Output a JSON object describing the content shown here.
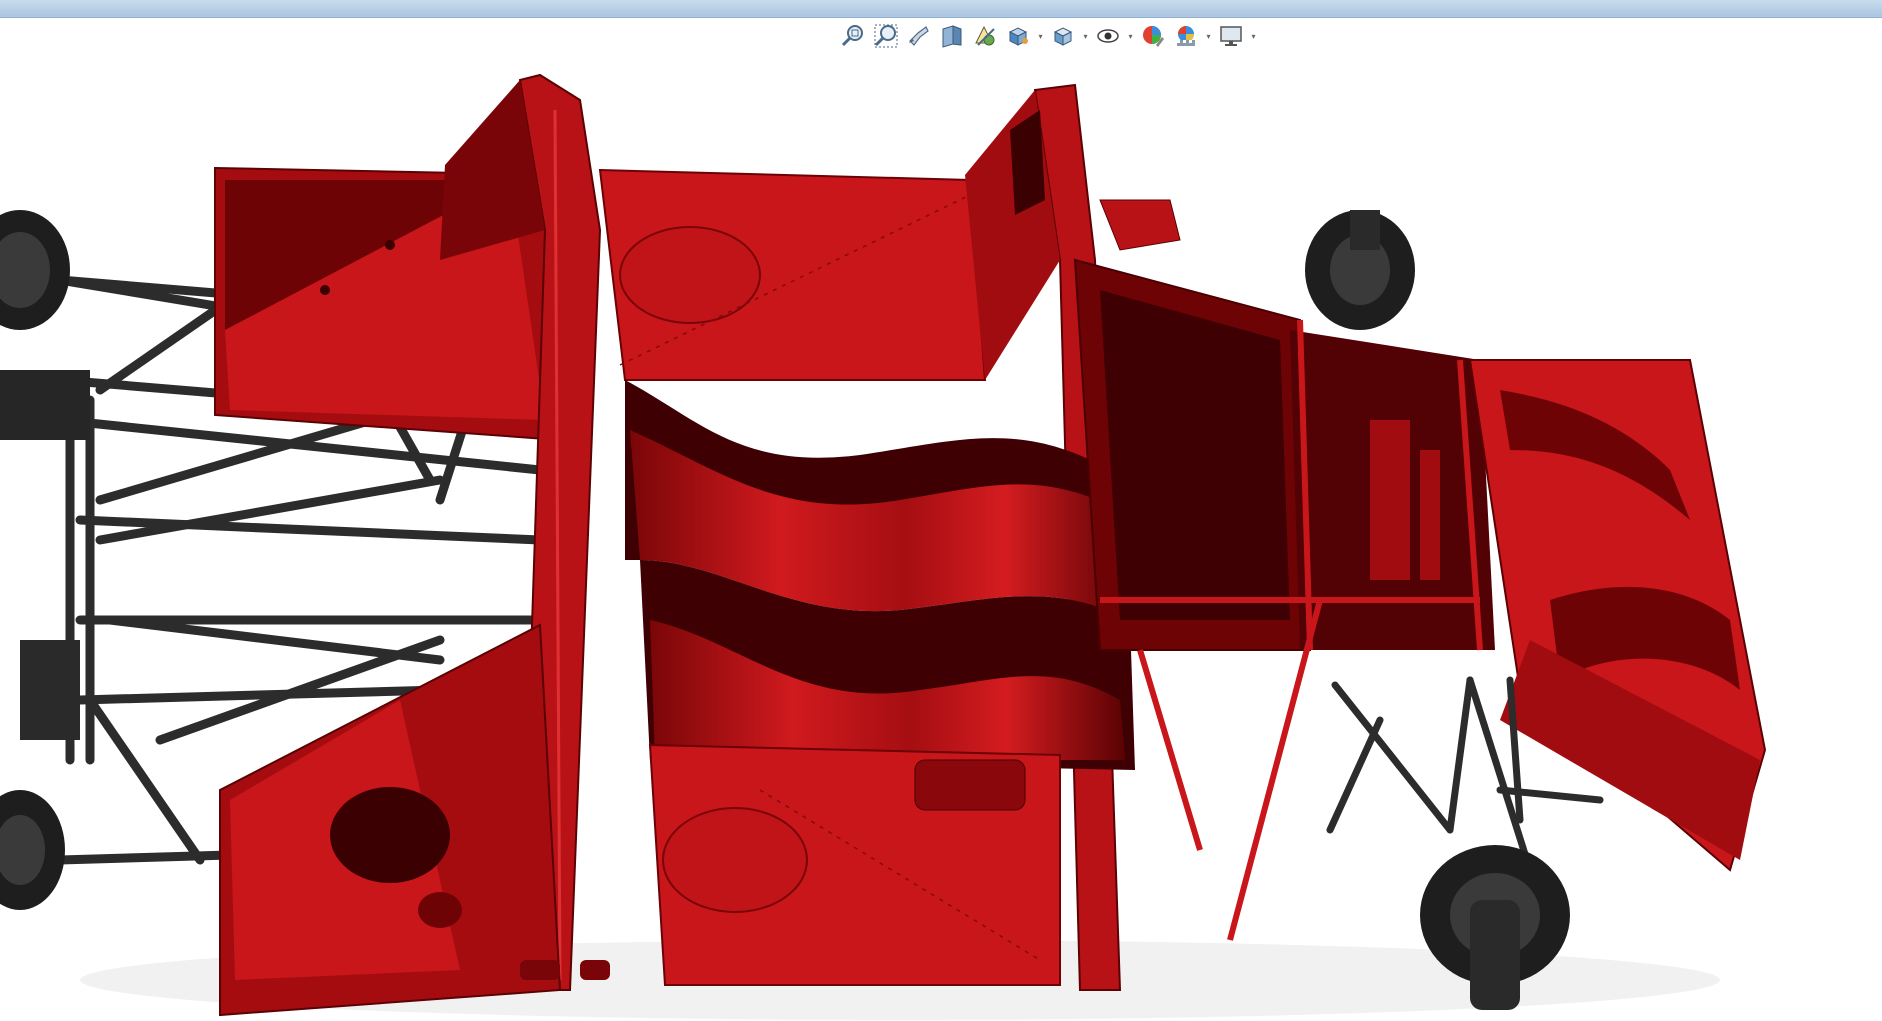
{
  "window": {
    "title_bar_color": "#b8d0e8"
  },
  "heads_up_toolbar": {
    "buttons": [
      {
        "name": "zoom-to-fit-icon",
        "has_dropdown": false
      },
      {
        "name": "zoom-to-area-icon",
        "has_dropdown": false
      },
      {
        "name": "previous-view-icon",
        "has_dropdown": false
      },
      {
        "name": "section-view-icon",
        "has_dropdown": false
      },
      {
        "name": "dynamic-annotation-views-icon",
        "has_dropdown": false
      },
      {
        "name": "view-orientation-icon",
        "has_dropdown": true
      },
      {
        "name": "display-style-icon",
        "has_dropdown": true
      },
      {
        "name": "hide-show-items-icon",
        "has_dropdown": true
      },
      {
        "name": "edit-appearance-icon",
        "has_dropdown": false
      },
      {
        "name": "apply-scene-icon",
        "has_dropdown": true
      },
      {
        "name": "view-settings-icon",
        "has_dropdown": true
      }
    ]
  },
  "model": {
    "description_colors": {
      "body_red": "#c8161a",
      "body_dark": "#4a0000",
      "frame_black": "#2a2a2a"
    }
  }
}
